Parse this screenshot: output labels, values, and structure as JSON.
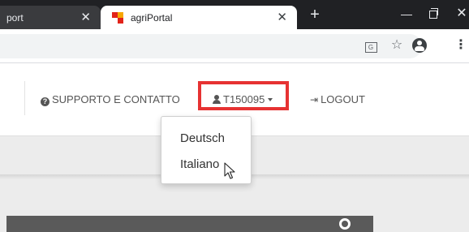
{
  "browser": {
    "tabs": [
      {
        "title": "port",
        "close": "✕"
      },
      {
        "title": "agriPortal",
        "close": "✕"
      }
    ],
    "new_tab": "+",
    "window_controls": {
      "minimize": "—",
      "close": "✕"
    },
    "toolbar_icons": [
      "translate-icon",
      "star-icon",
      "account-icon",
      "menu-icon"
    ],
    "star_glyph": "☆",
    "menu_glyph": "⋮"
  },
  "navbar": {
    "support_label": "SUPPORTO E CONTATTO",
    "user_label": "T150095",
    "logout_label": "LOGOUT"
  },
  "language_menu": {
    "items": [
      {
        "label": "Deutsch"
      },
      {
        "label": "Italiano"
      }
    ]
  },
  "colors": {
    "highlight": "#e63232",
    "tab_strip": "#202124",
    "dark_bar": "#5a5a5a"
  }
}
